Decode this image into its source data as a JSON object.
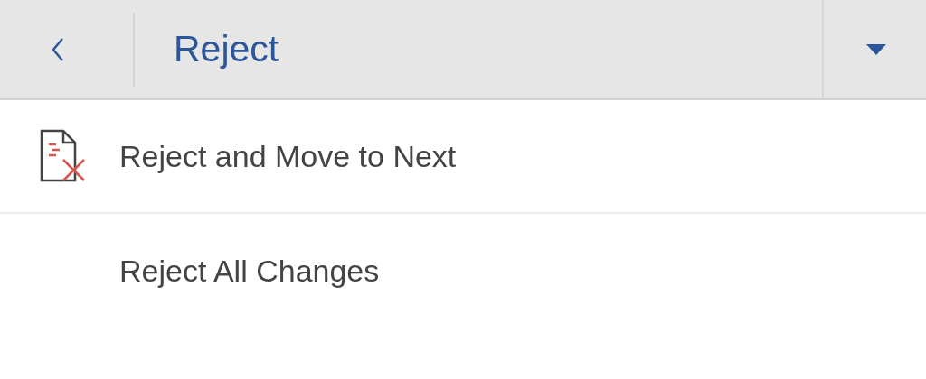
{
  "header": {
    "title": "Reject"
  },
  "items": [
    {
      "label": "Reject and Move to Next",
      "kind": "icon"
    },
    {
      "label": "Reject All Changes",
      "kind": "plain"
    }
  ]
}
